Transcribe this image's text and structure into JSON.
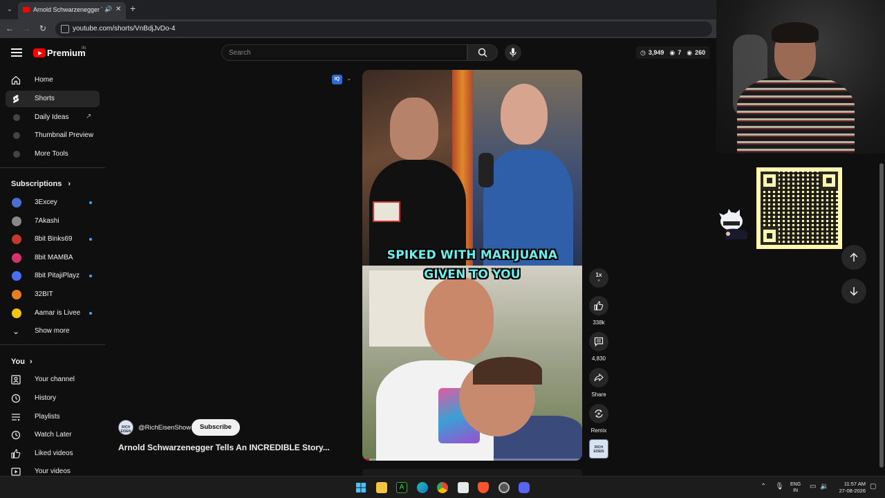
{
  "browser": {
    "tab_title": "Arnold Schwarzenegger Tel",
    "tab_audio_icon": "speaker-icon",
    "tab_close_glyph": "✕",
    "new_tab_glyph": "+",
    "url": "youtube.com/shorts/VnBdjJvDo-4"
  },
  "header": {
    "logo_text": "Premium",
    "logo_sup": "IN",
    "search_placeholder": "Search",
    "stats": {
      "time": "3,949",
      "watching": "7",
      "views": "260"
    }
  },
  "sidebar": {
    "main": [
      {
        "label": "Home",
        "icon": "home-icon"
      },
      {
        "label": "Shorts",
        "icon": "shorts-icon",
        "active": true
      },
      {
        "label": "Daily Ideas",
        "icon": "iq-icon",
        "external": true
      },
      {
        "label": "Thumbnail Preview",
        "icon": "iq-icon"
      },
      {
        "label": "More Tools",
        "icon": "iq-icon"
      }
    ],
    "subscriptions_title": "Subscriptions",
    "subscriptions": [
      {
        "label": "3Excey",
        "color": "#4a6fd0",
        "live": true
      },
      {
        "label": "7Akashi",
        "color": "#888888",
        "live": false
      },
      {
        "label": "8bit Binks69",
        "color": "#c0392b",
        "live": true
      },
      {
        "label": "8bit MAMBA",
        "color": "#d6336c",
        "live": false
      },
      {
        "label": "8bit PitajiPlayz",
        "color": "#4c6ef5",
        "live": true
      },
      {
        "label": "32BIT",
        "color": "#e67e22",
        "live": false
      },
      {
        "label": "Aamar is Livee",
        "color": "#f1c40f",
        "live": true
      }
    ],
    "show_more": "Show more",
    "you_title": "You",
    "you": [
      {
        "label": "Your channel",
        "icon": "channel-icon"
      },
      {
        "label": "History",
        "icon": "history-icon"
      },
      {
        "label": "Playlists",
        "icon": "playlist-icon"
      },
      {
        "label": "Watch Later",
        "icon": "clock-icon"
      },
      {
        "label": "Liked videos",
        "icon": "like-icon"
      },
      {
        "label": "Your videos",
        "icon": "video-icon"
      }
    ]
  },
  "video": {
    "caption_line1": "SPIKED WITH MARIJUANA",
    "caption_line2": "GIVEN TO YOU",
    "progress_fraction": 0.03,
    "iq_badge": "IQ",
    "speed": "1x",
    "likes": "338k",
    "comments": "4,830",
    "share_label": "Share",
    "remix_label": "Remix",
    "channel_thumb_text": "RICH EISEN"
  },
  "channel": {
    "handle": "@RichEisenShow",
    "subscribe_label": "Subscribe",
    "avatar_text": "RICH EISEN",
    "title": "Arnold Schwarzenegger Tells An INCREDIBLE Story..."
  },
  "taskbar": {
    "lang_line1": "ENG",
    "lang_line2": "IN",
    "time": "11:57 AM",
    "date": "27-08-2026"
  },
  "colors": {
    "yt_red": "#ff0000",
    "accent_blue": "#3ea6ff",
    "caption_cyan": "#69f0ee"
  }
}
